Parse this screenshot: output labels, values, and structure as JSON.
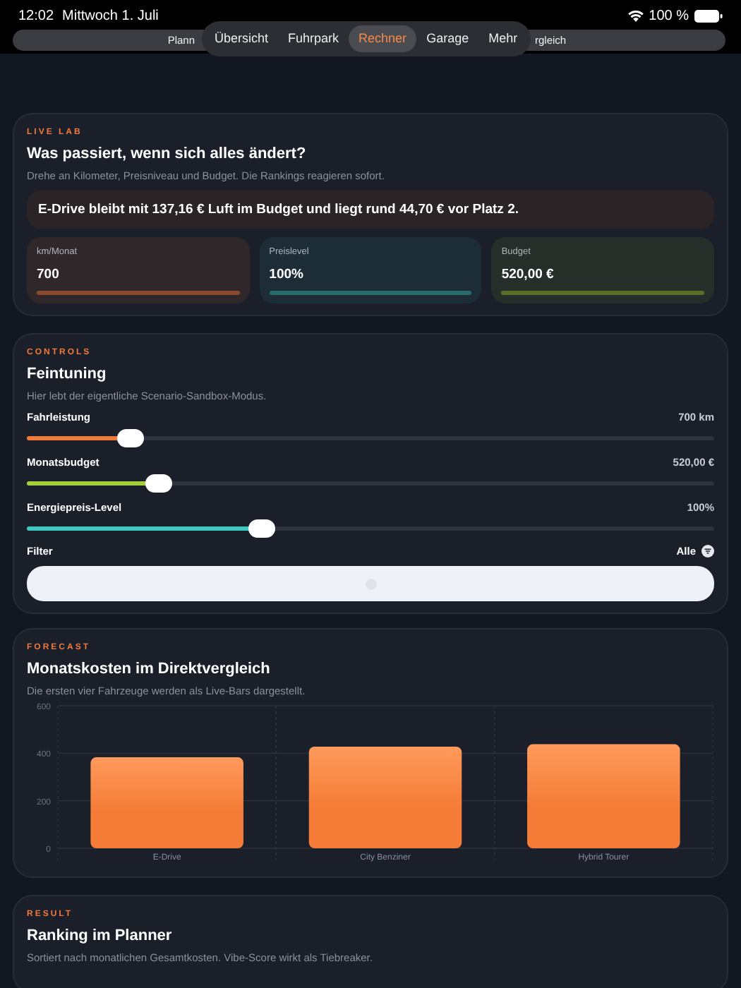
{
  "status_bar": {
    "time": "12:02",
    "date": "Mittwoch 1. Juli",
    "battery": "100 %"
  },
  "back_bar": {
    "left_text": "Plann",
    "right_text": "rgleich"
  },
  "tabs": [
    {
      "label": "Übersicht",
      "selected": false
    },
    {
      "label": "Fuhrpark",
      "selected": false
    },
    {
      "label": "Rechner",
      "selected": true
    },
    {
      "label": "Garage",
      "selected": false
    },
    {
      "label": "Mehr",
      "selected": false
    }
  ],
  "live_lab": {
    "eyebrow": "LIVE LAB",
    "title": "Was passiert, wenn sich alles ändert?",
    "subtitle": "Drehe an Kilometer, Preisniveau und Budget. Die Rankings reagieren sofort.",
    "summary": "E-Drive bleibt mit 137,16 € Luft im Budget und liegt rund 44,70 € vor Platz 2.",
    "stats": [
      {
        "label": "km/Monat",
        "value": "700",
        "color": "#8a4a2e"
      },
      {
        "label": "Preislevel",
        "value": "100%",
        "color": "#2a6b6e"
      },
      {
        "label": "Budget",
        "value": "520,00 €",
        "color": "#5a6e2a"
      }
    ]
  },
  "controls": {
    "eyebrow": "CONTROLS",
    "title": "Feintuning",
    "subtitle": "Hier lebt der eigentliche Scenario-Sandbox-Modus.",
    "sliders": [
      {
        "label": "Fahrleistung",
        "reading": "700 km",
        "level": 0.15,
        "color": "#f07a3a"
      },
      {
        "label": "Monatsbudget",
        "reading": "520,00 €",
        "level": 0.19,
        "color": "#a3cf3e"
      },
      {
        "label": "Energiepreis-Level",
        "reading": "100%",
        "level": 0.34,
        "color": "#3cc8c0"
      }
    ],
    "filter": {
      "label": "Filter",
      "value": "Alle"
    }
  },
  "forecast": {
    "eyebrow": "FORECAST",
    "title": "Monatskosten im Direktvergleich",
    "subtitle": "Die ersten vier Fahrzeuge werden als Live-Bars dargestellt.",
    "chart_data": {
      "type": "bar",
      "categories": [
        "E-Drive",
        "City Benziner",
        "Hybrid Tourer"
      ],
      "series": [
        {
          "color": "#f47c36",
          "values": [
            383,
            428,
            438
          ]
        }
      ],
      "ylim": [
        0,
        600
      ],
      "yticks": [
        0,
        200,
        400,
        600
      ]
    }
  },
  "result": {
    "eyebrow": "RESULT",
    "title": "Ranking im Planner",
    "subtitle": "Sortiert nach monatlichen Gesamtkosten. Vibe-Score wirkt als Tiebreaker."
  }
}
